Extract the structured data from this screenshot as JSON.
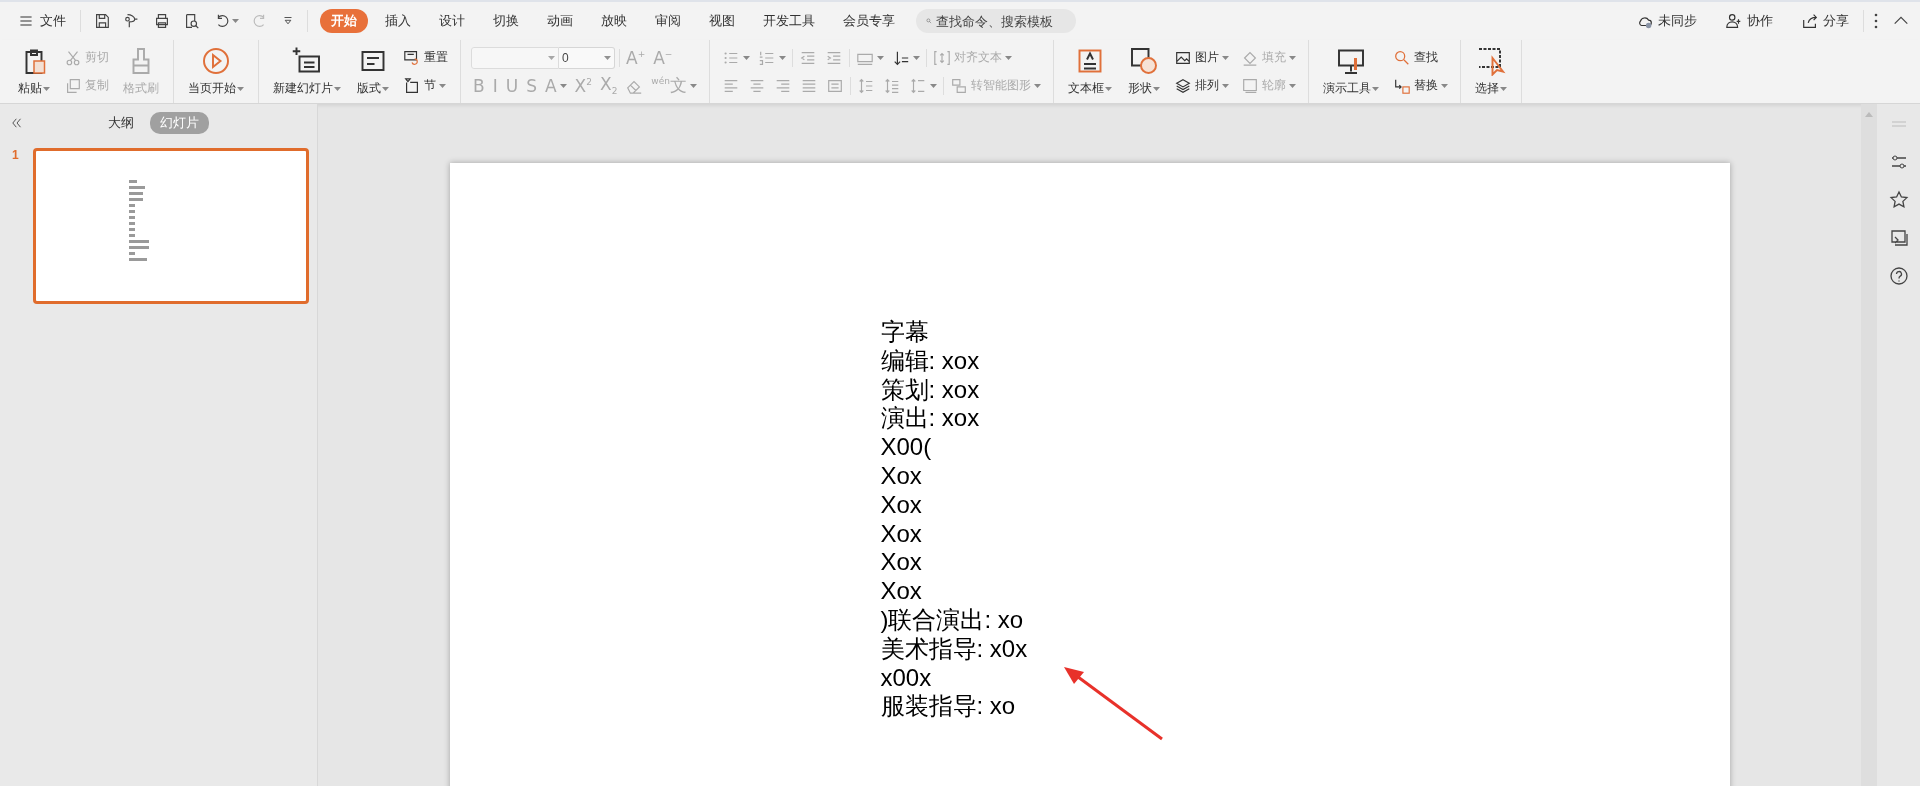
{
  "menu_bar": {
    "file_menu": "文件",
    "quick_access": [
      {
        "disabled": false,
        "dropdown": false
      },
      {
        "disabled": false,
        "dropdown": false
      },
      {
        "disabled": false,
        "dropdown": false
      },
      {
        "disabled": false,
        "dropdown": false
      },
      {
        "disabled": false,
        "dropdown": true
      },
      {
        "disabled": true,
        "dropdown": false
      }
    ],
    "tabs": [
      {
        "label": "开始",
        "selected": true
      },
      {
        "label": "插入",
        "selected": false
      },
      {
        "label": "设计",
        "selected": false
      },
      {
        "label": "切换",
        "selected": false
      },
      {
        "label": "动画",
        "selected": false
      },
      {
        "label": "放映",
        "selected": false
      },
      {
        "label": "审阅",
        "selected": false
      },
      {
        "label": "视图",
        "selected": false
      },
      {
        "label": "开发工具",
        "selected": false
      },
      {
        "label": "会员专享",
        "selected": false
      }
    ],
    "search": {
      "placeholder": "查找命令、搜索模板"
    },
    "actions": [
      {
        "label": "未同步"
      },
      {
        "label": "协作"
      },
      {
        "label": "分享"
      }
    ]
  },
  "ribbon": {
    "groups": [
      {
        "columns": [
          {
            "kind": "large",
            "label": "粘贴",
            "dropdown": true,
            "disabled": false
          },
          {
            "kind": "rows",
            "rows": [
              [
                [
                  {
                    "kind": "icon_text",
                    "label": "剪切",
                    "dropdown": false,
                    "disabled": true
                  }
                ]
              ],
              [
                [
                  {
                    "kind": "icon_text",
                    "label": "复制",
                    "dropdown": false,
                    "disabled": true
                  }
                ]
              ]
            ]
          },
          {
            "kind": "large",
            "label": "格式刷",
            "dropdown": false,
            "disabled": true
          }
        ]
      },
      {
        "columns": [
          {
            "kind": "large",
            "label": "当页开始",
            "dropdown": true,
            "disabled": false
          }
        ]
      },
      {
        "columns": [
          {
            "kind": "large",
            "label": "新建幻灯片",
            "dropdown": true,
            "disabled": false
          },
          {
            "kind": "large",
            "label": "版式",
            "dropdown": true,
            "disabled": false
          },
          {
            "kind": "rows",
            "rows": [
              [
                [
                  {
                    "kind": "icon_text",
                    "label": "重置",
                    "dropdown": false,
                    "disabled": false
                  }
                ]
              ],
              [
                [
                  {
                    "kind": "icon_text",
                    "label": "节",
                    "dropdown": true,
                    "disabled": false
                  }
                ]
              ]
            ]
          }
        ]
      },
      {
        "columns": [
          {
            "kind": "rows",
            "rows": [
              [
                [
                  {
                    "kind": "select",
                    "disabled": true,
                    "dropdown": true
                  },
                  {
                    "kind": "field",
                    "value": "0",
                    "disabled": true,
                    "dropdown": true
                  }
                ],
                [
                  {
                    "kind": "text",
                    "label": "A$^{+}$",
                    "dropdown": false,
                    "disabled": true
                  },
                  {
                    "kind": "text",
                    "label": "A$^{−}$",
                    "dropdown": false,
                    "disabled": true
                  }
                ]
              ],
              [
                [
                  {
                    "kind": "text",
                    "label": "B",
                    "dropdown": false,
                    "disabled": true
                  },
                  {
                    "kind": "text",
                    "label": "I",
                    "dropdown": false,
                    "disabled": true
                  },
                  {
                    "kind": "text",
                    "label": "U",
                    "dropdown": false,
                    "disabled": true
                  },
                  {
                    "kind": "text",
                    "label": "S",
                    "dropdown": false,
                    "disabled": true
                  },
                  {
                    "kind": "text",
                    "label": "A",
                    "dropdown": true,
                    "disabled": true
                  },
                  {
                    "kind": "text",
                    "label": "X$^{2}$",
                    "dropdown": false,
                    "disabled": true
                  },
                  {
                    "kind": "text",
                    "label": "X$_{2}$",
                    "dropdown": false,
                    "disabled": true
                  },
                  {
                    "kind": "icon",
                    "dropdown": false,
                    "disabled": true
                  },
                  {
                    "kind": "text",
                    "label": "$^{wén}$文",
                    "dropdown": true,
                    "disabled": true
                  }
                ]
              ]
            ]
          }
        ]
      },
      {
        "columns": [
          {
            "kind": "rows",
            "rows": [
              [
                [
                  {
                    "kind": "icon",
                    "dropdown": true,
                    "disabled": true
                  },
                  {
                    "kind": "icon",
                    "dropdown": true,
                    "disabled": true
                  }
                ],
                [
                  {
                    "kind": "icon",
                    "dropdown": false,
                    "disabled": true
                  },
                  {
                    "kind": "icon",
                    "dropdown": false,
                    "disabled": true
                  }
                ],
                [
                  {
                    "kind": "icon",
                    "dropdown": true,
                    "disabled": true
                  },
                  {
                    "kind": "icon",
                    "dropdown": true,
                    "disabled": false
                  }
                ],
                [
                  {
                    "kind": "icon_text",
                    "label": "对齐文本",
                    "dropdown": true,
                    "disabled": true
                  }
                ]
              ],
              [
                [
                  {
                    "kind": "icon",
                    "dropdown": false,
                    "disabled": true
                  },
                  {
                    "kind": "icon",
                    "dropdown": false,
                    "disabled": true
                  },
                  {
                    "kind": "icon",
                    "dropdown": false,
                    "disabled": true
                  },
                  {
                    "kind": "icon",
                    "dropdown": false,
                    "disabled": true
                  },
                  {
                    "kind": "icon",
                    "dropdown": false,
                    "disabled": true
                  }
                ],
                [
                  {
                    "kind": "icon",
                    "dropdown": false,
                    "disabled": true
                  },
                  {
                    "kind": "icon",
                    "dropdown": false,
                    "disabled": true
                  },
                  {
                    "kind": "icon",
                    "dropdown": true,
                    "disabled": true
                  }
                ],
                [
                  {
                    "kind": "icon_text",
                    "label": "转智能图形",
                    "dropdown": true,
                    "disabled": true
                  }
                ]
              ]
            ]
          }
        ]
      },
      {
        "columns": [
          {
            "kind": "large",
            "label": "文本框",
            "dropdown": true,
            "disabled": false
          },
          {
            "kind": "large",
            "label": "形状",
            "dropdown": true,
            "disabled": false
          },
          {
            "kind": "rows",
            "rows": [
              [
                [
                  {
                    "kind": "icon_text",
                    "label": "图片",
                    "dropdown": true,
                    "disabled": false
                  }
                ]
              ],
              [
                [
                  {
                    "kind": "icon_text",
                    "label": "排列",
                    "dropdown": true,
                    "disabled": false
                  }
                ]
              ]
            ]
          },
          {
            "kind": "rows",
            "rows": [
              [
                [
                  {
                    "kind": "icon_text",
                    "label": "填充",
                    "dropdown": true,
                    "disabled": true
                  }
                ]
              ],
              [
                [
                  {
                    "kind": "icon_text",
                    "label": "轮廓",
                    "dropdown": true,
                    "disabled": true
                  }
                ]
              ]
            ]
          }
        ]
      },
      {
        "columns": [
          {
            "kind": "large",
            "label": "演示工具",
            "dropdown": true,
            "disabled": false
          },
          {
            "kind": "rows",
            "rows": [
              [
                [
                  {
                    "kind": "icon_text",
                    "label": "查找",
                    "dropdown": false,
                    "disabled": false
                  }
                ]
              ],
              [
                [
                  {
                    "kind": "icon_text",
                    "label": "替换",
                    "dropdown": true,
                    "disabled": false
                  }
                ]
              ]
            ]
          }
        ]
      },
      {
        "columns": [
          {
            "kind": "large",
            "label": "选择",
            "dropdown": true,
            "disabled": false
          }
        ]
      }
    ]
  },
  "left_panel": {
    "tabs": [
      {
        "label": "大纲",
        "selected": false
      },
      {
        "label": "幻灯片",
        "selected": true
      }
    ],
    "slides": [
      {
        "number": "1",
        "selected": true
      }
    ]
  },
  "slide": {
    "lines": [
      "字幕",
      "编辑: xox",
      "策划: xox",
      "演出: xox",
      "X00(",
      "Xox",
      "Xox",
      "Xox",
      "Xox",
      "Xox",
      ")联合演出: xo",
      "美术指导: x0x",
      "x00x",
      "服装指导: xo"
    ]
  }
}
